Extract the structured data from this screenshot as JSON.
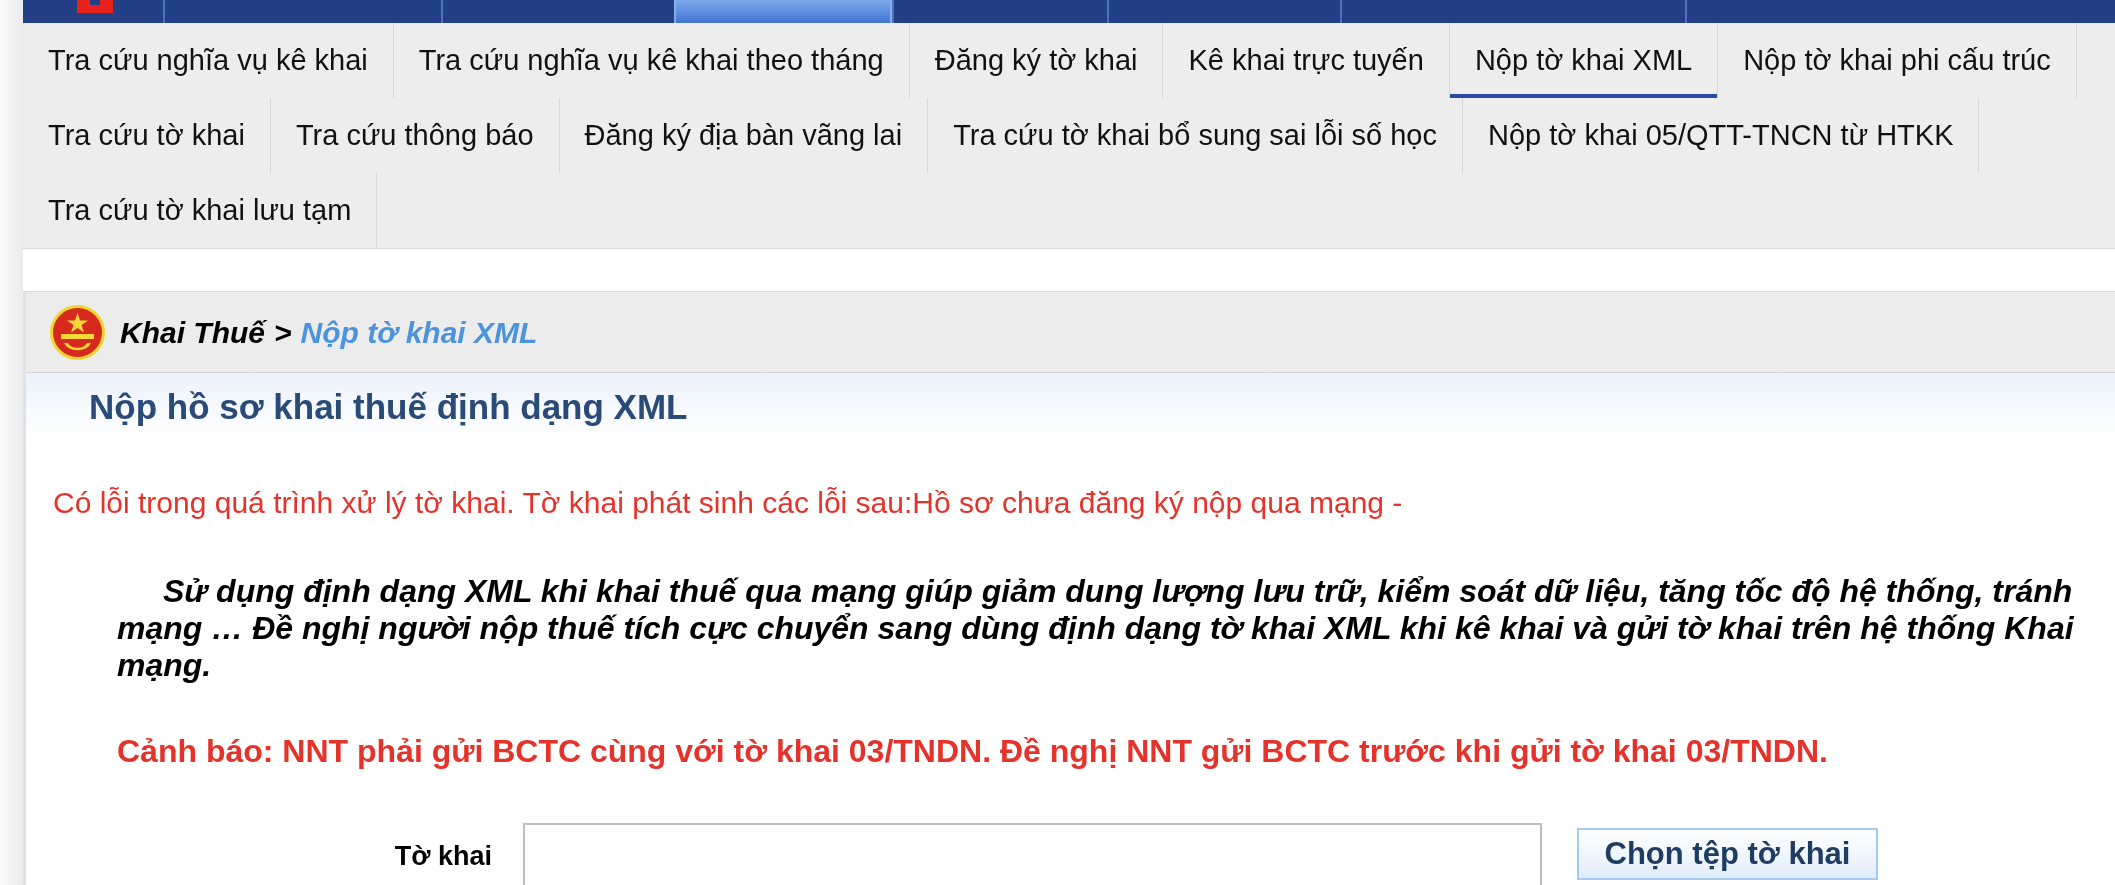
{
  "top_nav": {
    "items": [
      {
        "selected": false
      },
      {
        "selected": false
      },
      {
        "selected": true
      },
      {
        "selected": false
      },
      {
        "selected": false
      },
      {
        "selected": false
      },
      {
        "selected": false
      }
    ]
  },
  "submenu": {
    "rows": [
      {
        "items": [
          {
            "label": "Tra cứu nghĩa vụ kê khai",
            "selected": false
          },
          {
            "label": "Tra cứu nghĩa vụ kê khai theo tháng",
            "selected": false
          },
          {
            "label": "Đăng ký tờ khai",
            "selected": false
          },
          {
            "label": "Kê khai trực tuyến",
            "selected": false
          },
          {
            "label": "Nộp tờ khai XML",
            "selected": true
          },
          {
            "label": "Nộp tờ khai phi cấu trúc",
            "selected": false
          }
        ]
      },
      {
        "items": [
          {
            "label": "Tra cứu tờ khai",
            "selected": false
          },
          {
            "label": "Tra cứu thông báo",
            "selected": false
          },
          {
            "label": "Đăng ký địa bàn vãng lai",
            "selected": false
          },
          {
            "label": "Tra cứu tờ khai bổ sung sai lỗi số học",
            "selected": false
          },
          {
            "label": "Nộp tờ khai 05/QTT-TNCN từ HTKK",
            "selected": false
          }
        ]
      },
      {
        "items": [
          {
            "label": "Tra cứu tờ khai lưu tạm",
            "selected": false
          }
        ]
      }
    ]
  },
  "breadcrumb": {
    "items": [
      {
        "label": "Khai Thuế",
        "current": false
      },
      {
        "label": "Nộp tờ khai XML",
        "current": true
      }
    ],
    "separator": ">"
  },
  "page_title": "Nộp hồ sơ khai thuế định dạng XML",
  "error_message": "Có lỗi trong quá trình xử lý tờ khai. Tờ khai phát sinh các lỗi sau:Hồ sơ chưa đăng ký nộp qua mạng -",
  "notice": {
    "lines": [
      "Sử dụng định dạng XML khi khai thuế qua mạng giúp giảm dung lượng lưu trữ, kiểm soát dữ liệu, tăng tốc độ hệ thống, tránh",
      "mạng … Đề nghị người nộp thuế tích cực chuyển sang dùng định dạng tờ khai XML khi kê khai và gửi tờ khai trên hệ thống Khai",
      "mạng."
    ]
  },
  "warning": "Cảnh báo: NNT phải gửi BCTC cùng với tờ khai 03/TNDN. Đề nghị NNT gửi BCTC trước khi gửi tờ khai 03/TNDN.",
  "form": {
    "field_label": "Tờ khai",
    "browse_button": "Chọn tệp tờ khai"
  }
}
